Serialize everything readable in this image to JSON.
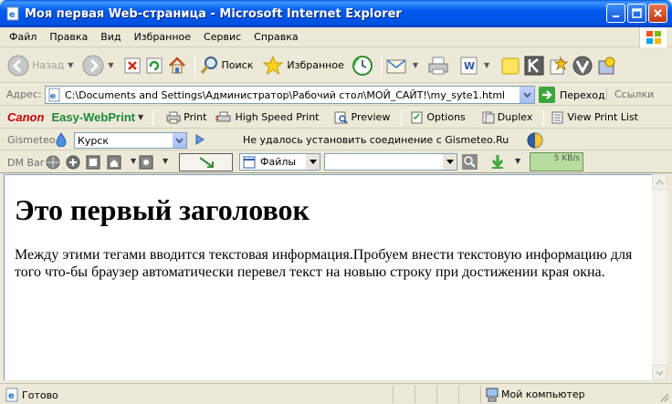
{
  "window": {
    "title": "Моя первая Web-страница - Microsoft Internet Explorer"
  },
  "menu": [
    "Файл",
    "Правка",
    "Вид",
    "Избранное",
    "Сервис",
    "Справка"
  ],
  "toolbar": {
    "back": "Назад",
    "search": "Поиск",
    "favorites": "Избранное"
  },
  "address": {
    "label": "Адрес:",
    "url": "C:\\Documents and Settings\\Администратор\\Рабочий стол\\МОЙ_САЙТ!\\my_syte1.html",
    "go": "Переход",
    "links": "Ссылки"
  },
  "canon": {
    "logo": "Canon",
    "product": "Easy-WebPrint",
    "print": "Print",
    "high_speed": "High Speed Print",
    "preview": "Preview",
    "options": "Options",
    "duplex": "Duplex",
    "view_list": "View Print List"
  },
  "gismeteo": {
    "label": "Gismeteo",
    "city": "Курск",
    "status": "Не удалось установить соединение с Gismeteo.Ru"
  },
  "dmbar": {
    "label": "DM Bar",
    "files": "Файлы",
    "speed": "5 KB/s"
  },
  "page": {
    "heading": "Это первый заголовок",
    "paragraph": "Между этими тегами вводится текстовая информация.Пробуем внести текстовую информацию для того что-бы браузер автоматически перевел текст на новыю строку при достижении края окна."
  },
  "status": {
    "text": "Готово",
    "zone": "Мой компьютер"
  }
}
